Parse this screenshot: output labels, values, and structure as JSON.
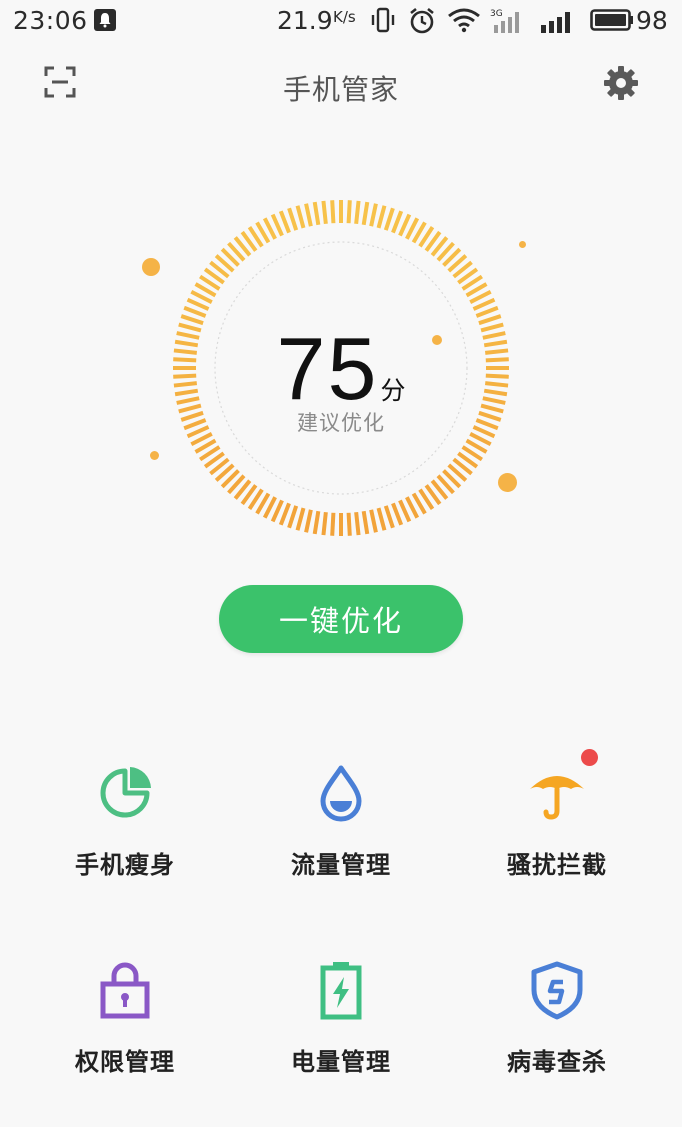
{
  "status_bar": {
    "time": "23:06",
    "speed_value": "21.9",
    "speed_unit": "K/s",
    "battery": "98",
    "icons": [
      "notification-icon",
      "vibrate-icon",
      "alarm-icon",
      "wifi-icon",
      "signal-3g-icon",
      "signal-icon",
      "battery-icon"
    ]
  },
  "header": {
    "title": "手机管家",
    "left_icon": "scan-icon",
    "right_icon": "gear-icon"
  },
  "score": {
    "value": "75",
    "unit": "分",
    "hint": "建议优化",
    "level": 0.75,
    "colors": {
      "start": "#f7c24a",
      "end": "#f2a33a"
    }
  },
  "optimize_button": {
    "label": "一键优化",
    "color": "#3bc26b"
  },
  "features": [
    {
      "label": "手机瘦身",
      "icon": "pie-chart-icon",
      "color": "#4dbf83"
    },
    {
      "label": "流量管理",
      "icon": "water-drop-icon",
      "color": "#4a7fd6"
    },
    {
      "label": "骚扰拦截",
      "icon": "umbrella-icon",
      "color": "#f5a623",
      "badge": true
    },
    {
      "label": "权限管理",
      "icon": "lock-icon",
      "color": "#8a58c6"
    },
    {
      "label": "电量管理",
      "icon": "battery-charge-icon",
      "color": "#3fbf83"
    },
    {
      "label": "病毒查杀",
      "icon": "shield-icon",
      "color": "#4a7fd6"
    }
  ]
}
